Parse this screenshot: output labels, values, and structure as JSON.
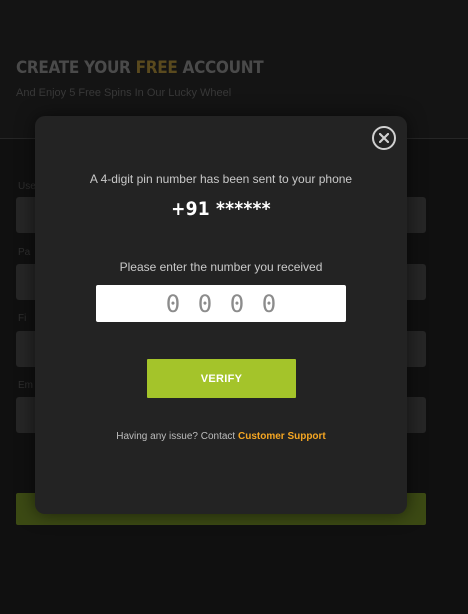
{
  "background": {
    "title_prefix": "CREATE YOUR",
    "title_accent": "FREE",
    "title_suffix": "ACCOUNT",
    "subtitle": "And Enjoy 5 Free Spins In Our Lucky Wheel",
    "field_labels": [
      "User",
      "Pa",
      "Fi",
      "Em"
    ]
  },
  "modal": {
    "sent_message": "A 4-digit pin number has been sent to your phone",
    "phone_number": "+91 ******",
    "enter_prompt": "Please enter the number you received",
    "pin_placeholder": [
      "0",
      "0",
      "0",
      "0"
    ],
    "verify_label": "VERIFY",
    "support_text": "Having any issue? Contact",
    "support_link": "Customer Support",
    "close_icon": "close-icon"
  },
  "colors": {
    "accent_green": "#a4c42a",
    "link_orange": "#f5a623",
    "modal_bg": "#232323"
  }
}
